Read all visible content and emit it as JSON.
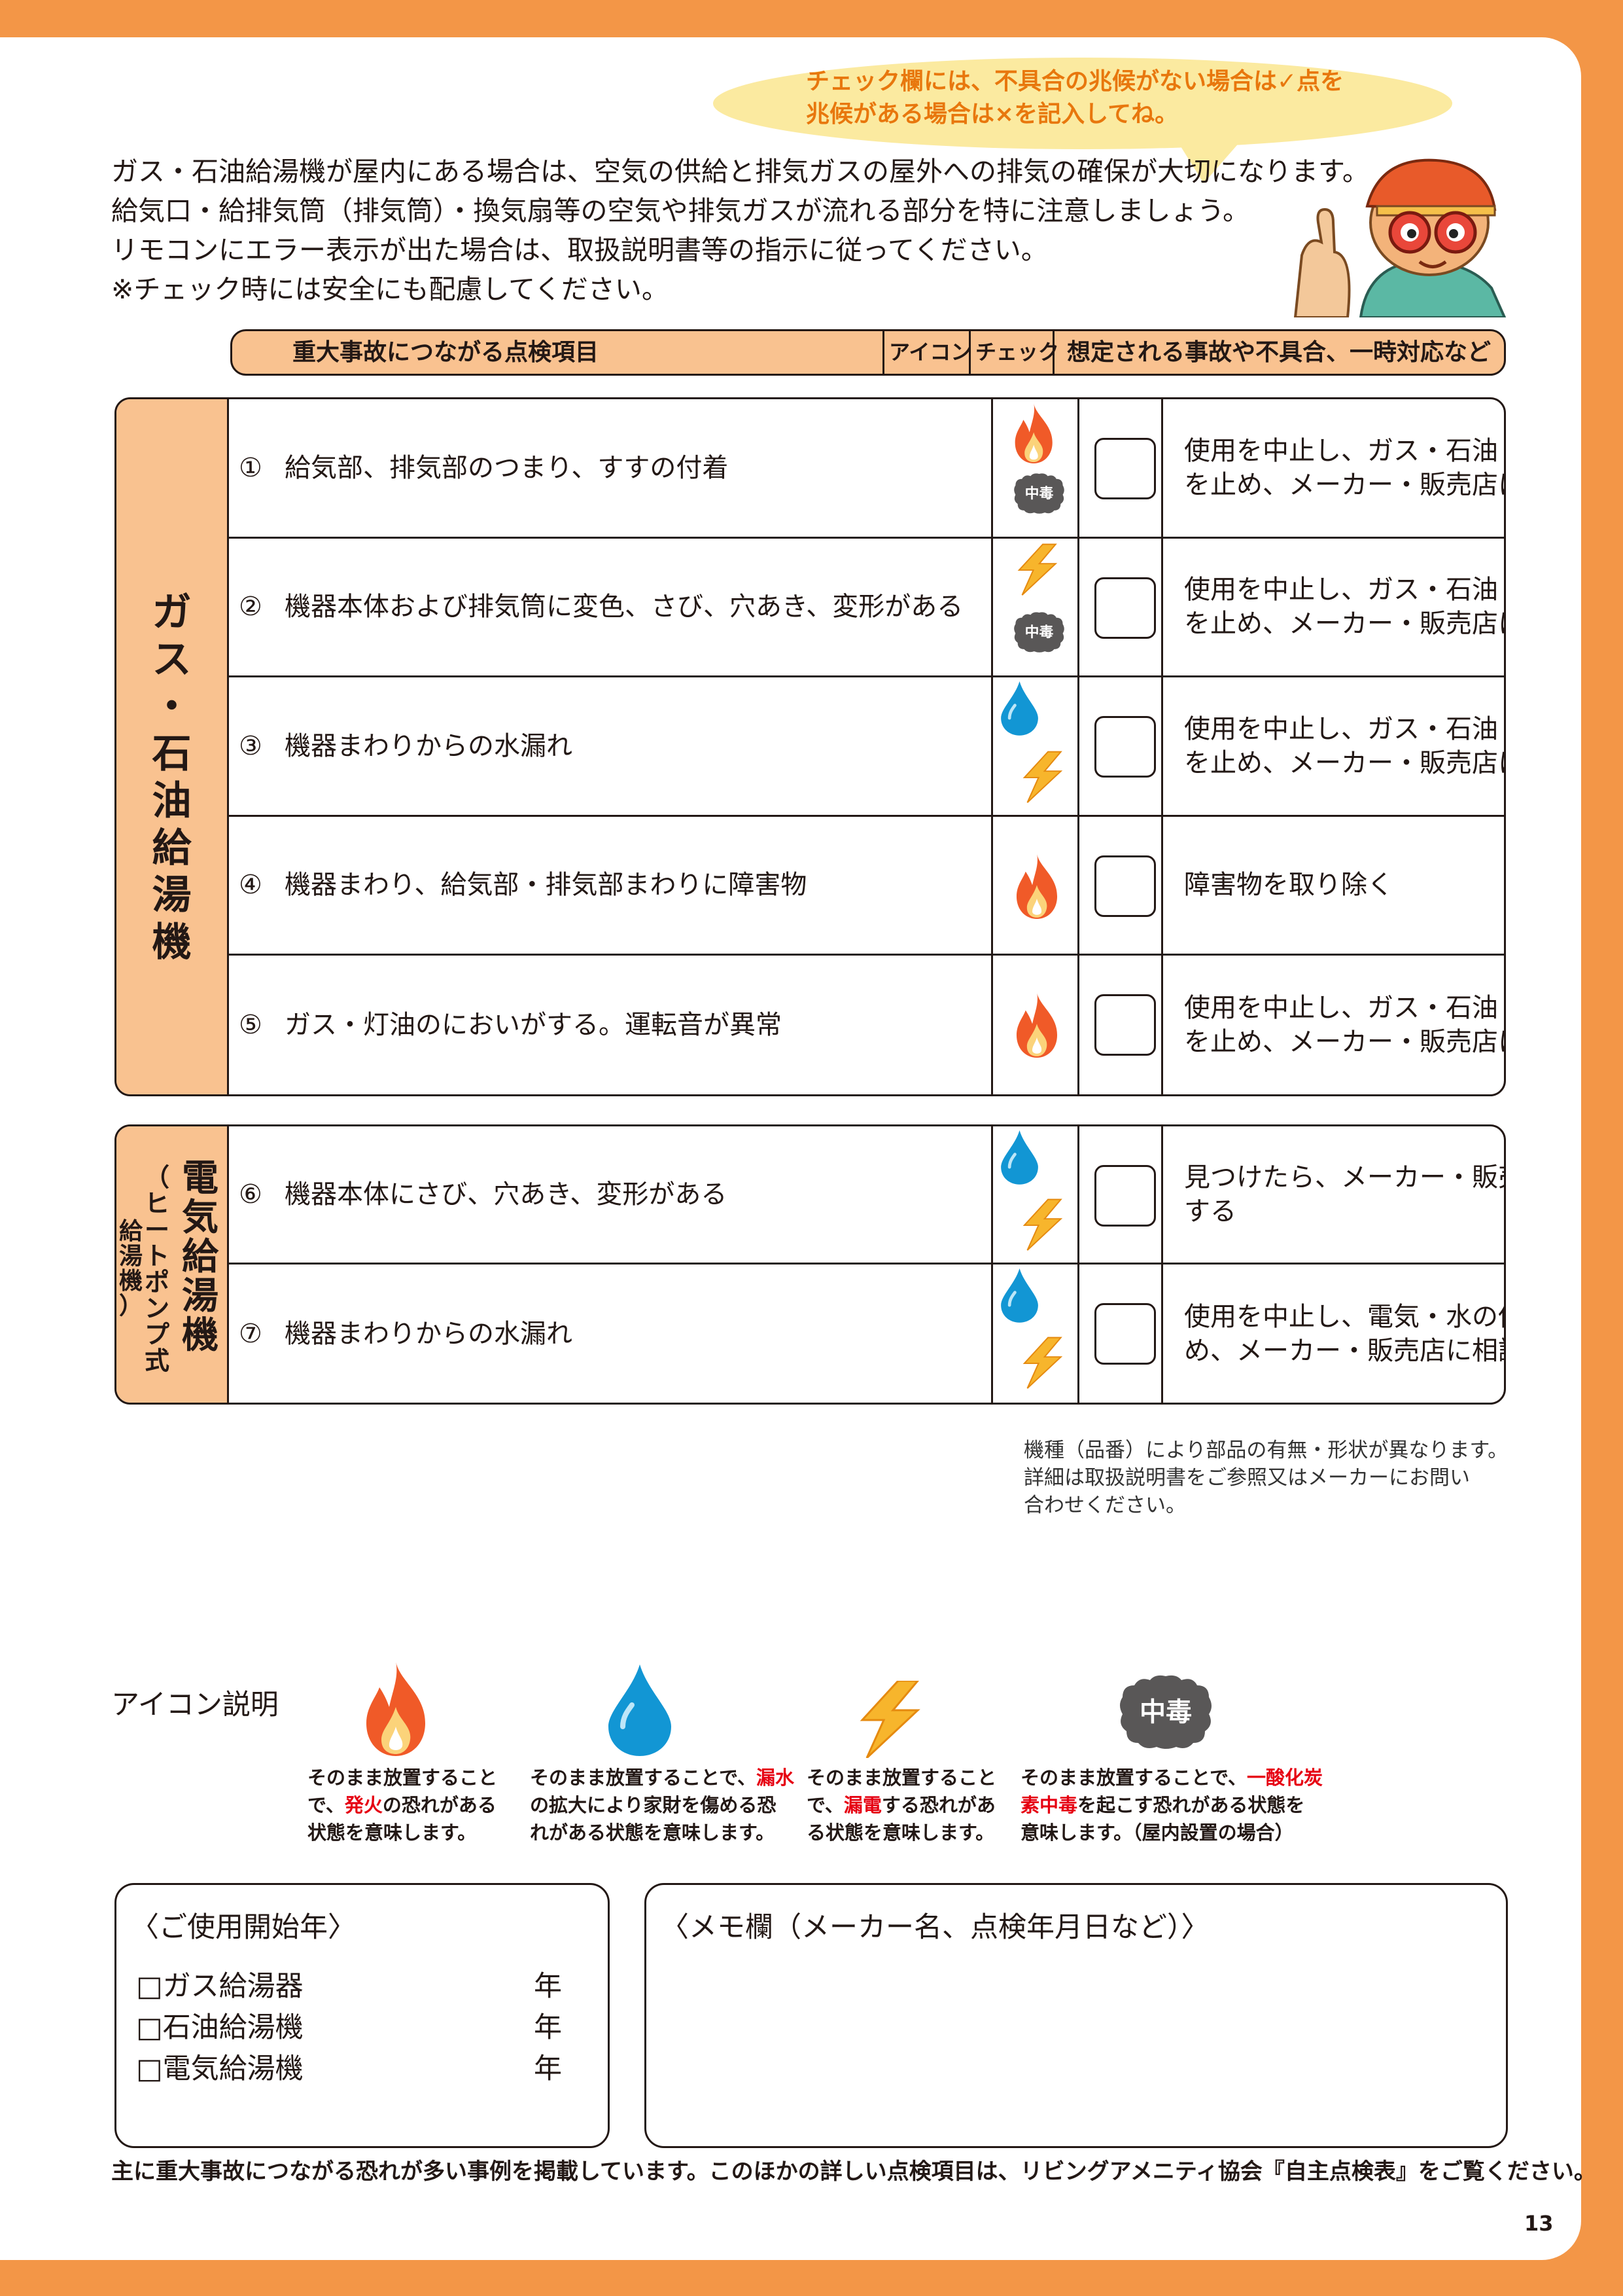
{
  "bubble": {
    "line1": "チェック欄には、不具合の兆候がない場合は✓点を",
    "line2": "兆候がある場合は×を記入してね。"
  },
  "intro": {
    "line1": "ガス・石油給湯機が屋内にある場合は、空気の供給と排気ガスの屋外への排気の確保が大切になります。",
    "line2": "給気口・給排気筒（排気筒）・換気扇等の空気や排気ガスが流れる部分を特に注意しましょう。",
    "line3": "リモコンにエラー表示が出た場合は、取扱説明書等の指示に従ってください。",
    "line4": "※チェック時には安全にも配慮してください。"
  },
  "header": {
    "item": "重大事故につながる点検項目",
    "icon": "アイコン",
    "check": "チェック",
    "action": "想定される事故や不具合、一時対応など"
  },
  "gas_section": {
    "title": "ガス・石油給湯機",
    "rows": [
      {
        "num": "①",
        "text": "給気部、排気部のつまり、すすの付着",
        "icons": [
          "fire-icon",
          "poison-icon"
        ],
        "action": "使用を中止し、ガス・石油・水の供給を止め、メーカー・販売店に相談する"
      },
      {
        "num": "②",
        "text": "機器本体および排気筒に変色、さび、穴あき、変形がある",
        "icons": [
          "lightning-icon",
          "poison-icon"
        ],
        "action": "使用を中止し、ガス・石油・水の供給を止め、メーカー・販売店に相談する"
      },
      {
        "num": "③",
        "text": "機器まわりからの水漏れ",
        "icons": [
          "water-icon",
          "lightning-icon"
        ],
        "action": "使用を中止し、ガス・石油・水の供給を止め、メーカー・販売店に相談する"
      },
      {
        "num": "④",
        "text": "機器まわり、給気部・排気部まわりに障害物",
        "icons": [
          "fire-icon"
        ],
        "action": "障害物を取り除く"
      },
      {
        "num": "⑤",
        "text": "ガス・灯油のにおいがする。運転音が異常",
        "icons": [
          "fire-icon"
        ],
        "action": "使用を中止し、ガス・石油・水の供給を止め、メーカー・販売店に相談する"
      }
    ]
  },
  "electric_section": {
    "title": "電気給湯機",
    "subtitle": "（ヒートポンプ式",
    "subtitle2": "給湯機）",
    "rows": [
      {
        "num": "⑥",
        "text": "機器本体にさび、穴あき、変形がある",
        "icons": [
          "water-icon",
          "lightning-icon"
        ],
        "action": "見つけたら、メーカー・販売店に相談する"
      },
      {
        "num": "⑦",
        "text": "機器まわりからの水漏れ",
        "icons": [
          "water-icon",
          "lightning-icon"
        ],
        "action": "使用を中止し、電気・水の供給を止め、メーカー・販売店に相談する"
      }
    ]
  },
  "note": {
    "line1": "機種（品番）により部品の有無・形状が異なります。",
    "line2": "詳細は取扱説明書をご参照又はメーカーにお問い",
    "line3": "合わせください。"
  },
  "legend": {
    "title": "アイコン説明",
    "poison_label": "中毒",
    "fire": {
      "pre": "そのまま放置すること",
      "mid_pre": "で、",
      "hl": "発火",
      "post": "の恐れがある",
      "last": "状態を意味します。"
    },
    "water": {
      "pre": "そのまま放置することで、",
      "hl": "漏水",
      "l2": "の拡大により家財を傷める恐",
      "l3": "れがある状態を意味します。"
    },
    "elec": {
      "l1": "そのまま放置すること",
      "pre": "で、",
      "hl": "漏電",
      "post": "する恐れがあ",
      "l3": "る状態を意味します。"
    },
    "poison": {
      "pre": "そのまま放置することで、",
      "hl1": "一酸化炭",
      "hl2": "素中毒",
      "post": "を起こす恐れがある状態を",
      "l3": "意味します。（屋内設置の場合）"
    }
  },
  "start_year": {
    "title": "〈ご使用開始年〉",
    "rows": [
      {
        "label": "□ガス給湯器",
        "unit": "年"
      },
      {
        "label": "□石油給湯機",
        "unit": "年"
      },
      {
        "label": "□電気給湯機",
        "unit": "年"
      }
    ]
  },
  "memo": {
    "title": "〈メモ欄（メーカー名、点検年月日など）〉"
  },
  "footer": "主に重大事故につながる恐れが多い事例を掲載しています。このほかの詳しい点検項目は、リビングアメニティ協会『自主点検表』をご覧ください。",
  "page_number": "13",
  "colors": {
    "accent": "#f39647",
    "header_fill": "#f9c290",
    "bubble": "#fbeaa0",
    "bubble_text": "#e8770d",
    "highlight": "#e60012"
  }
}
